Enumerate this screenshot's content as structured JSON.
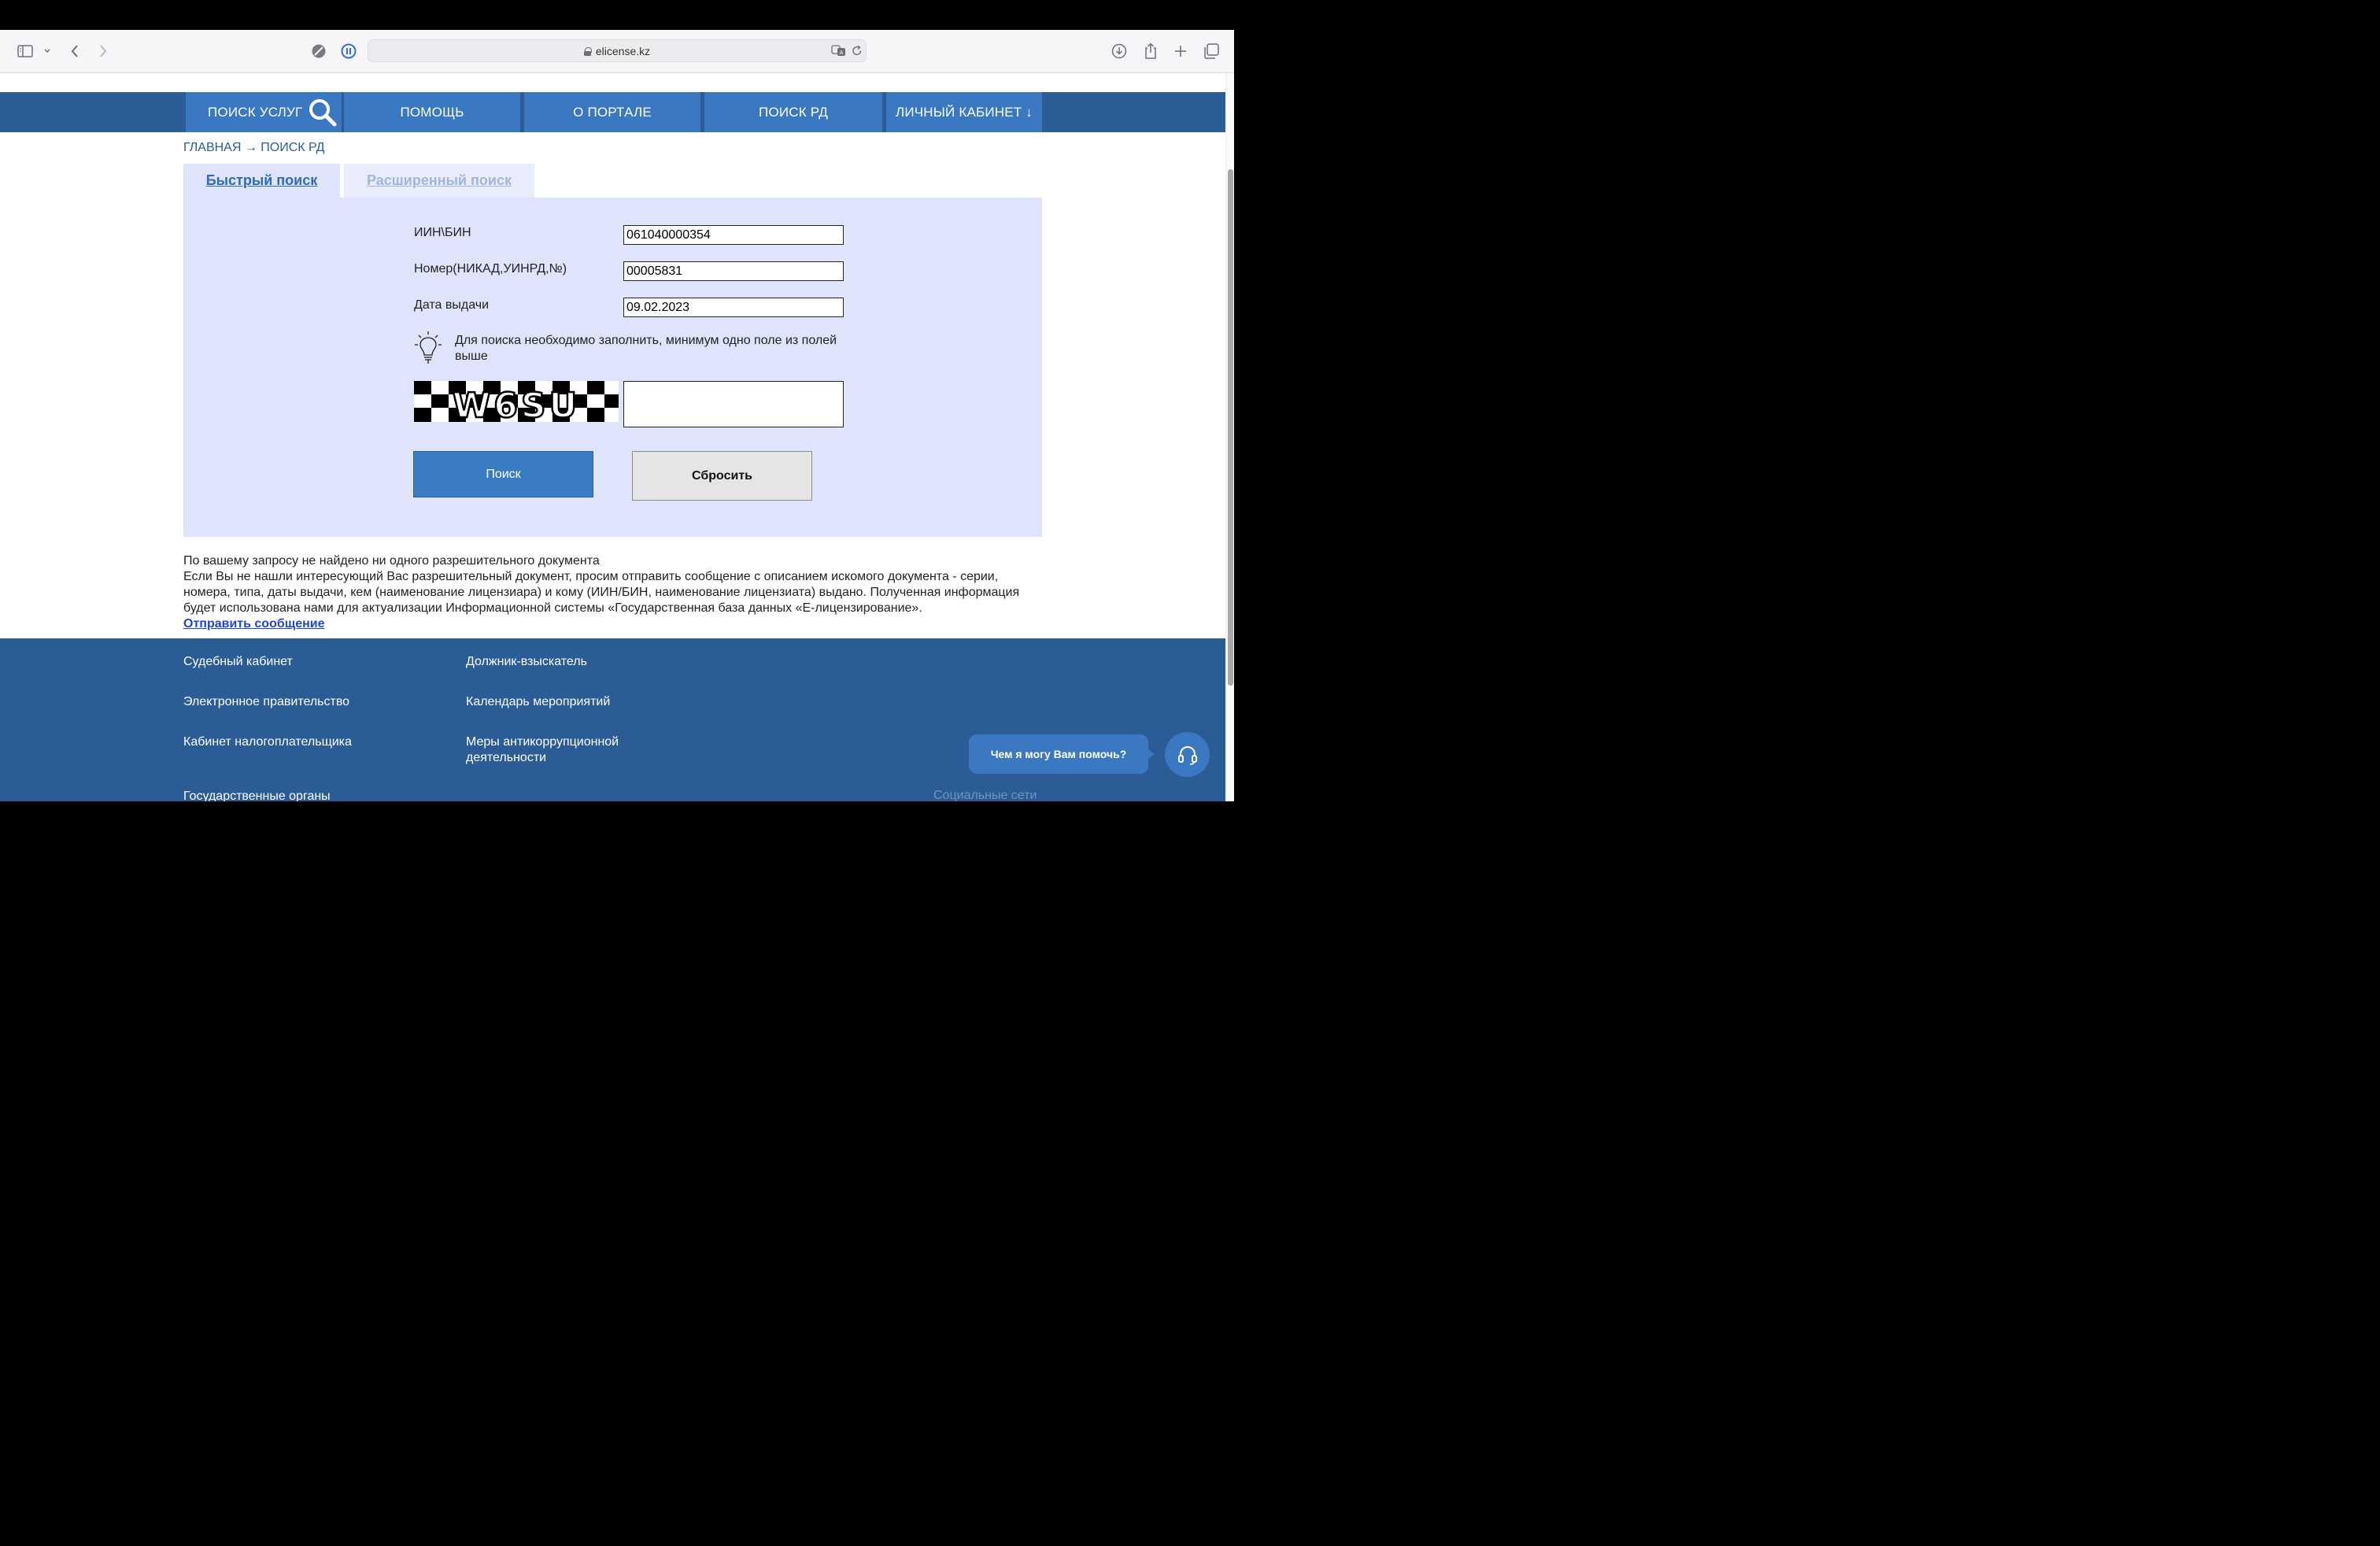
{
  "browser": {
    "url": "elicense.kz"
  },
  "nav": {
    "search_services": "ПОИСК УСЛУГ",
    "help": "ПОМОЩЬ",
    "about": "О ПОРТАЛЕ",
    "search_rd": "ПОИСК РД",
    "cabinet": "ЛИЧНЫЙ КАБИНЕТ ↓"
  },
  "breadcrumb": "ГЛАВНАЯ → ПОИСК РД",
  "tabs": {
    "quick": "Быстрый поиск",
    "advanced": "Расширенный поиск"
  },
  "form": {
    "iin_label": "ИИН\\БИН",
    "iin_value": "061040000354",
    "number_label": "Номер(НИКАД,УИНРД,№)",
    "number_value": "00005831",
    "date_label": "Дата выдачи",
    "date_value": "09.02.2023",
    "hint": "Для поиска необходимо заполнить, минимум одно поле из полей выше",
    "captcha_text": "W6SU",
    "captcha_value": "",
    "search_button": "Поиск",
    "reset_button": "Сбросить"
  },
  "result": {
    "not_found": "По вашему запросу не найдено ни одного разрешительного документа",
    "description": "Если Вы не нашли интересующий Вас разрешительный документ, просим отправить сообщение с описанием искомого документа - серии, номера, типа, даты выдачи, кем (наименование лицензиара) и кому (ИИН/БИН, наименование лицензиата) выдано. Полученная информация будет использована нами для актуализации Информационной системы «Государственная база данных «Е-лицензирование».",
    "send_link": "Отправить сообщение"
  },
  "footer": {
    "col1": [
      "Судебный кабинет",
      "Электронное правительство",
      "Кабинет налогоплательщика",
      "Государственные органы"
    ],
    "col2": [
      "Должник-взыскатель",
      "Календарь мероприятий",
      "Меры антикоррупционной деятельности"
    ],
    "social": "Социальные сети"
  },
  "chat": {
    "label": "Чем я могу Вам помочь?"
  },
  "colors": {
    "nav_bg": "#2c5d96",
    "nav_item": "#3a78c2",
    "panel_bg": "#dfe3fb",
    "footer_bg": "#2b5c96",
    "link": "#2046c8"
  }
}
